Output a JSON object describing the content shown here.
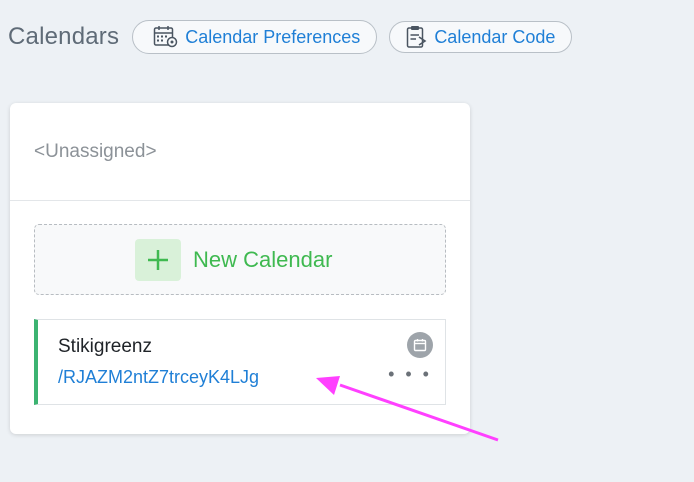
{
  "header": {
    "title": "Calendars",
    "preferences_label": "Calendar Preferences",
    "code_label": "Calendar Code"
  },
  "unassigned_section": {
    "title": "<Unassigned>",
    "new_calendar_label": "New Calendar"
  },
  "calendars": [
    {
      "name": "Stikigreenz",
      "code": "/RJAZM2ntZ7trceyK4LJg",
      "menu": "• • •"
    }
  ],
  "colors": {
    "accent_link": "#1f7fd6",
    "new_green": "#3fb950",
    "calendar_stripe": "#3cb371",
    "annotation_arrow": "#ff40ff"
  },
  "icons": {
    "preferences": "calendar-gear-icon",
    "code": "clipboard-code-icon",
    "add": "plus-icon",
    "calendar_badge": "calendar-icon",
    "menu": "ellipsis-icon"
  }
}
